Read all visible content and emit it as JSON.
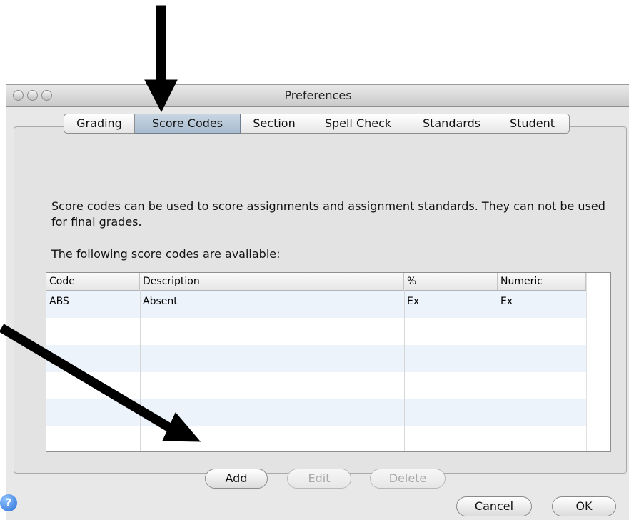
{
  "window": {
    "title": "Preferences"
  },
  "tabs": [
    "Grading",
    "Score Codes",
    "Section",
    "Spell Check",
    "Standards",
    "Student"
  ],
  "active_tab": "Score Codes",
  "content": {
    "description": "Score codes can be used to score assignments and assignment standards. They can not be used for final grades.",
    "available_label": "The following score codes are available:"
  },
  "table": {
    "columns": [
      "Code",
      "Description",
      "%",
      "Numeric"
    ],
    "rows": [
      {
        "code": "ABS",
        "description": "Absent",
        "percent": "Ex",
        "numeric": "Ex"
      }
    ]
  },
  "buttons": {
    "add": "Add",
    "edit": "Edit",
    "delete": "Delete",
    "cancel": "Cancel",
    "ok": "OK"
  },
  "help": {
    "icon": "help-icon",
    "glyph": "?"
  },
  "colors": {
    "active_tab": "#b3c4d6",
    "alt_row": "#edf3fb",
    "help": "#2b6fd6"
  }
}
